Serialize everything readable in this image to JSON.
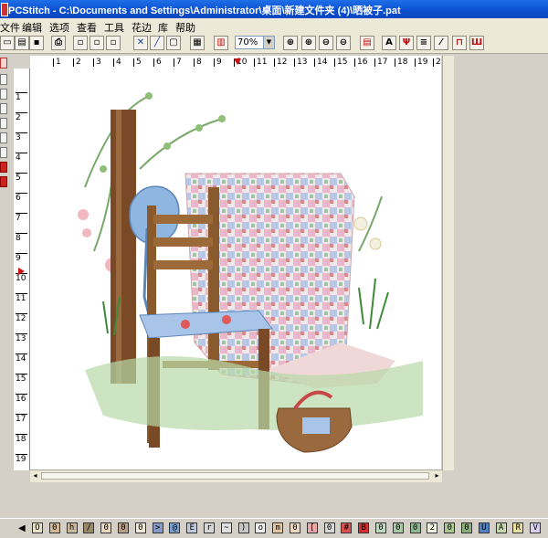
{
  "window": {
    "title": "PCStitch - C:\\Documents and Settings\\Administrator\\桌面\\新建文件夹 (4)\\晒被子.pat"
  },
  "menu": [
    "文件",
    "编辑",
    "选项",
    "查看",
    "工具",
    "花边",
    "库",
    "帮助"
  ],
  "toolbar": {
    "zoom_value": "70%",
    "letter_tool": "A",
    "icons": [
      "new-icon",
      "open-icon",
      "save-icon",
      "print-icon",
      "copy-icon",
      "cut-icon",
      "paste-icon",
      "full-stitch-icon",
      "backstitch-icon",
      "select-icon",
      "grid-icon",
      "palette-icon",
      "zoom-in-icon",
      "zoom-out-icon",
      "zoom-fit-icon",
      "zoom-reset-icon",
      "symbol-icon",
      "text-icon",
      "fill-icon",
      "eraser-icon",
      "eyedropper-icon",
      "highlight-icon"
    ]
  },
  "ruler": {
    "horizontal": [
      "1",
      "2",
      "3",
      "4",
      "5",
      "6",
      "7",
      "8",
      "9",
      "10",
      "11",
      "12",
      "13",
      "14",
      "15",
      "16",
      "17",
      "18",
      "19",
      "2"
    ],
    "vertical": [
      "1",
      "2",
      "3",
      "4",
      "5",
      "6",
      "7",
      "8",
      "9",
      "10",
      "11",
      "12",
      "13",
      "14",
      "15",
      "16",
      "17",
      "18",
      "19"
    ]
  },
  "palette": {
    "symbols": [
      "O",
      "0",
      "h",
      "/",
      "0",
      "0",
      "0",
      ">",
      "@",
      "E",
      "r",
      "~",
      ")",
      "o",
      "m",
      "0",
      "[",
      "0",
      "#",
      "B",
      "0",
      "0",
      "0",
      "2",
      "0",
      "0",
      "U",
      "A",
      "R",
      "V"
    ],
    "colors": [
      "#e8e0c8",
      "#d0b898",
      "#c8b8a0",
      "#9a8a6a",
      "#e8d8c0",
      "#b8a088",
      "#f0e8d8",
      "#8898c8",
      "#7aa0d0",
      "#c0c8e0",
      "#d8d8d8",
      "#e0e0e0",
      "#c8c8c8",
      "#f0f0f0",
      "#e8c8a0",
      "#f0d8c0",
      "#e8a8a8",
      "#d8d8d8",
      "#d85050",
      "#d03030",
      "#c0d8c0",
      "#a8c8a8",
      "#90b890",
      "#f0f0e0",
      "#a8c890",
      "#88b078",
      "#5080c0",
      "#c8d8b0",
      "#e8e0a0",
      "#d8d0f0"
    ]
  }
}
